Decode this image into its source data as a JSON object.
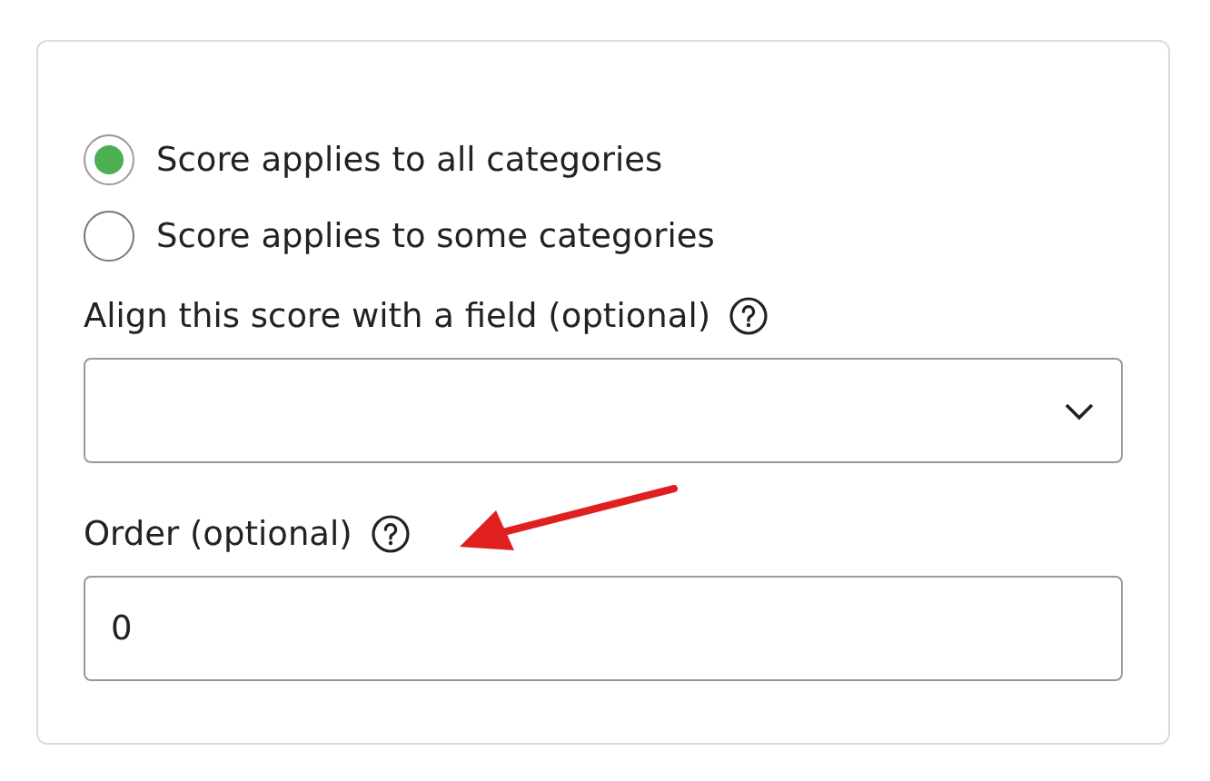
{
  "radios": [
    {
      "label": "Score applies to all categories",
      "selected": true
    },
    {
      "label": "Score applies to some categories",
      "selected": false
    }
  ],
  "fields": [
    {
      "kind": "select",
      "label": "Align this score with a field (optional)"
    },
    {
      "kind": "text",
      "label": "Order (optional)",
      "value": "0"
    }
  ]
}
